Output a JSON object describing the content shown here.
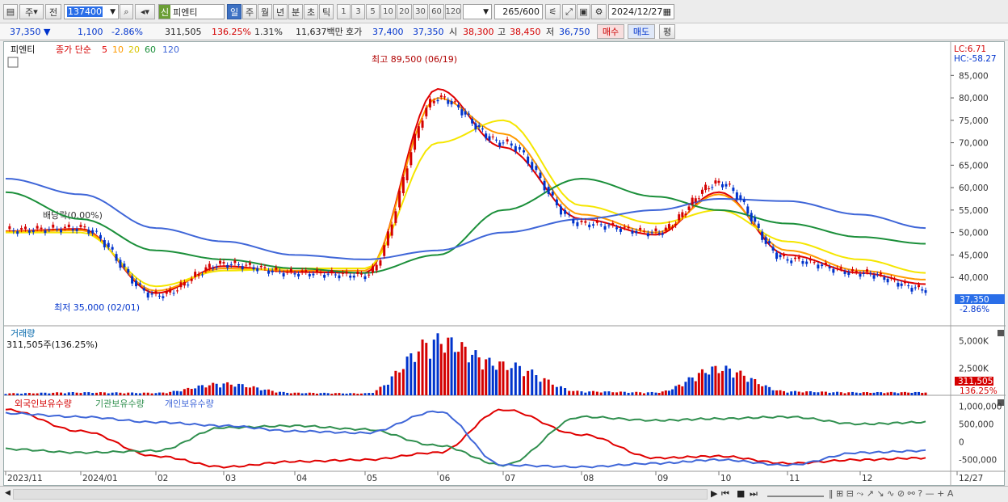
{
  "toolbar": {
    "period_type": "주",
    "period_prefix": "전",
    "stock_code": "137400",
    "credit_badge": "신",
    "stock_name": "피엔티",
    "intervals": [
      "일",
      "주",
      "월",
      "년",
      "분",
      "초",
      "틱"
    ],
    "interval_numbers": [
      "1",
      "3",
      "5",
      "10",
      "20",
      "30",
      "60",
      "120"
    ],
    "count_value": "265",
    "count_total": "/600",
    "date_value": "2024/12/27"
  },
  "quote": {
    "price": "37,350",
    "change": "1,100",
    "change_pct": "-2.86%",
    "volume": "311,505",
    "volume_ratio": "136.25%",
    "turnover_pct": "1.31%",
    "amount": "11,637백만",
    "bid_label": "호가",
    "bid": "37,400",
    "ask": "37,350",
    "open_label": "시",
    "open": "38,300",
    "high_label": "고",
    "high": "38,450",
    "low_label": "저",
    "low": "36,750",
    "buy_label": "매수",
    "sell_label": "매도",
    "avg_label": "평"
  },
  "chart": {
    "legend_name": "피엔티",
    "ma_label": "종가 단순",
    "ma_periods": [
      "5",
      "10",
      "20",
      "60",
      "120"
    ],
    "lc": "LC:6.71",
    "hc": "HC:-58.27",
    "high_annotation": "최고 89,500 (06/19)",
    "low_annotation": "최저 35,000 (02/01)",
    "dividend_annotation": "배당락(0.00%)",
    "price_ticks": [
      "85,000",
      "80,000",
      "75,000",
      "70,000",
      "65,000",
      "60,000",
      "55,000",
      "50,000",
      "45,000",
      "40,000"
    ],
    "last_price_tag": "37,350",
    "last_change_tag": "-2.86%",
    "volume_title": "거래량",
    "volume_value": "311,505주(136.25%)",
    "volume_ticks": [
      "5,000K",
      "2,500K"
    ],
    "volume_last": "311,505",
    "volume_ratio": "136.25%",
    "holdings_titles": [
      "외국인보유수량",
      "기관보유수량",
      "개인보유수량"
    ],
    "holdings_ticks": [
      "1,000,000",
      "500,000",
      "0",
      "-500,000"
    ],
    "x_labels": [
      "2023/11",
      "2024/01",
      "02",
      "03",
      "04",
      "05",
      "06",
      "07",
      "08",
      "09",
      "10",
      "11",
      "12",
      "12/27"
    ]
  },
  "chart_data": {
    "type": "line",
    "title": "",
    "xlabel": "",
    "ylabel": "",
    "ylim": [
      33000,
      91000
    ],
    "x": [
      "2023/11",
      "2024/01",
      "02",
      "03",
      "04",
      "05",
      "06",
      "07",
      "08",
      "09",
      "10",
      "11",
      "12",
      "12/27"
    ],
    "series": [
      {
        "name": "종가",
        "values": [
          50500,
          51000,
          36000,
          43000,
          41000,
          40500,
          80000,
          70000,
          52000,
          50000,
          61000,
          44000,
          41000,
          37350
        ]
      },
      {
        "name": "5",
        "values": [
          50300,
          50800,
          36500,
          42500,
          41200,
          41000,
          82000,
          69000,
          53000,
          49500,
          59000,
          45000,
          41000,
          38500
        ]
      },
      {
        "name": "10",
        "values": [
          50200,
          50500,
          37000,
          42000,
          41500,
          41500,
          80000,
          72000,
          54000,
          50000,
          58500,
          46000,
          41500,
          39500
        ]
      },
      {
        "name": "20",
        "values": [
          50000,
          50000,
          38000,
          41500,
          42000,
          42000,
          70000,
          75000,
          56000,
          52000,
          55000,
          48000,
          44000,
          41000
        ]
      },
      {
        "name": "60",
        "values": [
          59000,
          53000,
          46000,
          44000,
          42000,
          41000,
          45000,
          55000,
          62000,
          58000,
          55000,
          52000,
          49000,
          47500
        ]
      },
      {
        "name": "120",
        "values": [
          62000,
          58500,
          51000,
          48000,
          45000,
          44000,
          46000,
          50000,
          53000,
          55000,
          57500,
          57000,
          54000,
          51000
        ]
      }
    ],
    "volume": {
      "values_k": [
        200,
        300,
        250,
        1200,
        250,
        200,
        5700,
        3200,
        400,
        300,
        2800,
        400,
        300,
        311
      ]
    },
    "holdings": [
      {
        "name": "외국인보유수량",
        "values": [
          900000,
          300000,
          -400000,
          -700000,
          -550000,
          -500000,
          -300000,
          900000,
          200000,
          -450000,
          -400000,
          -600000,
          -500000,
          -450000
        ]
      },
      {
        "name": "기관보유수량",
        "values": [
          -200000,
          -300000,
          -250000,
          400000,
          450000,
          350000,
          -100000,
          -650000,
          700000,
          600000,
          650000,
          700000,
          500000,
          550000
        ]
      },
      {
        "name": "개인보유수량",
        "values": [
          800000,
          700000,
          550000,
          450000,
          300000,
          250000,
          850000,
          -650000,
          -700000,
          -600000,
          -500000,
          -650000,
          -300000,
          -250000
        ]
      }
    ],
    "grid": false,
    "legend_position": "top-left"
  },
  "colors": {
    "price_up": "#d40000",
    "price_down": "#0033cc",
    "ma5": "#e00000",
    "ma10": "#ff9a00",
    "ma20": "#f5e600",
    "ma60": "#1b8f3a",
    "ma120": "#3f66d8",
    "foreign": "#e00000",
    "institution": "#2f8f4e",
    "individual": "#3f66d8",
    "selected_button": "#3d71c3"
  }
}
